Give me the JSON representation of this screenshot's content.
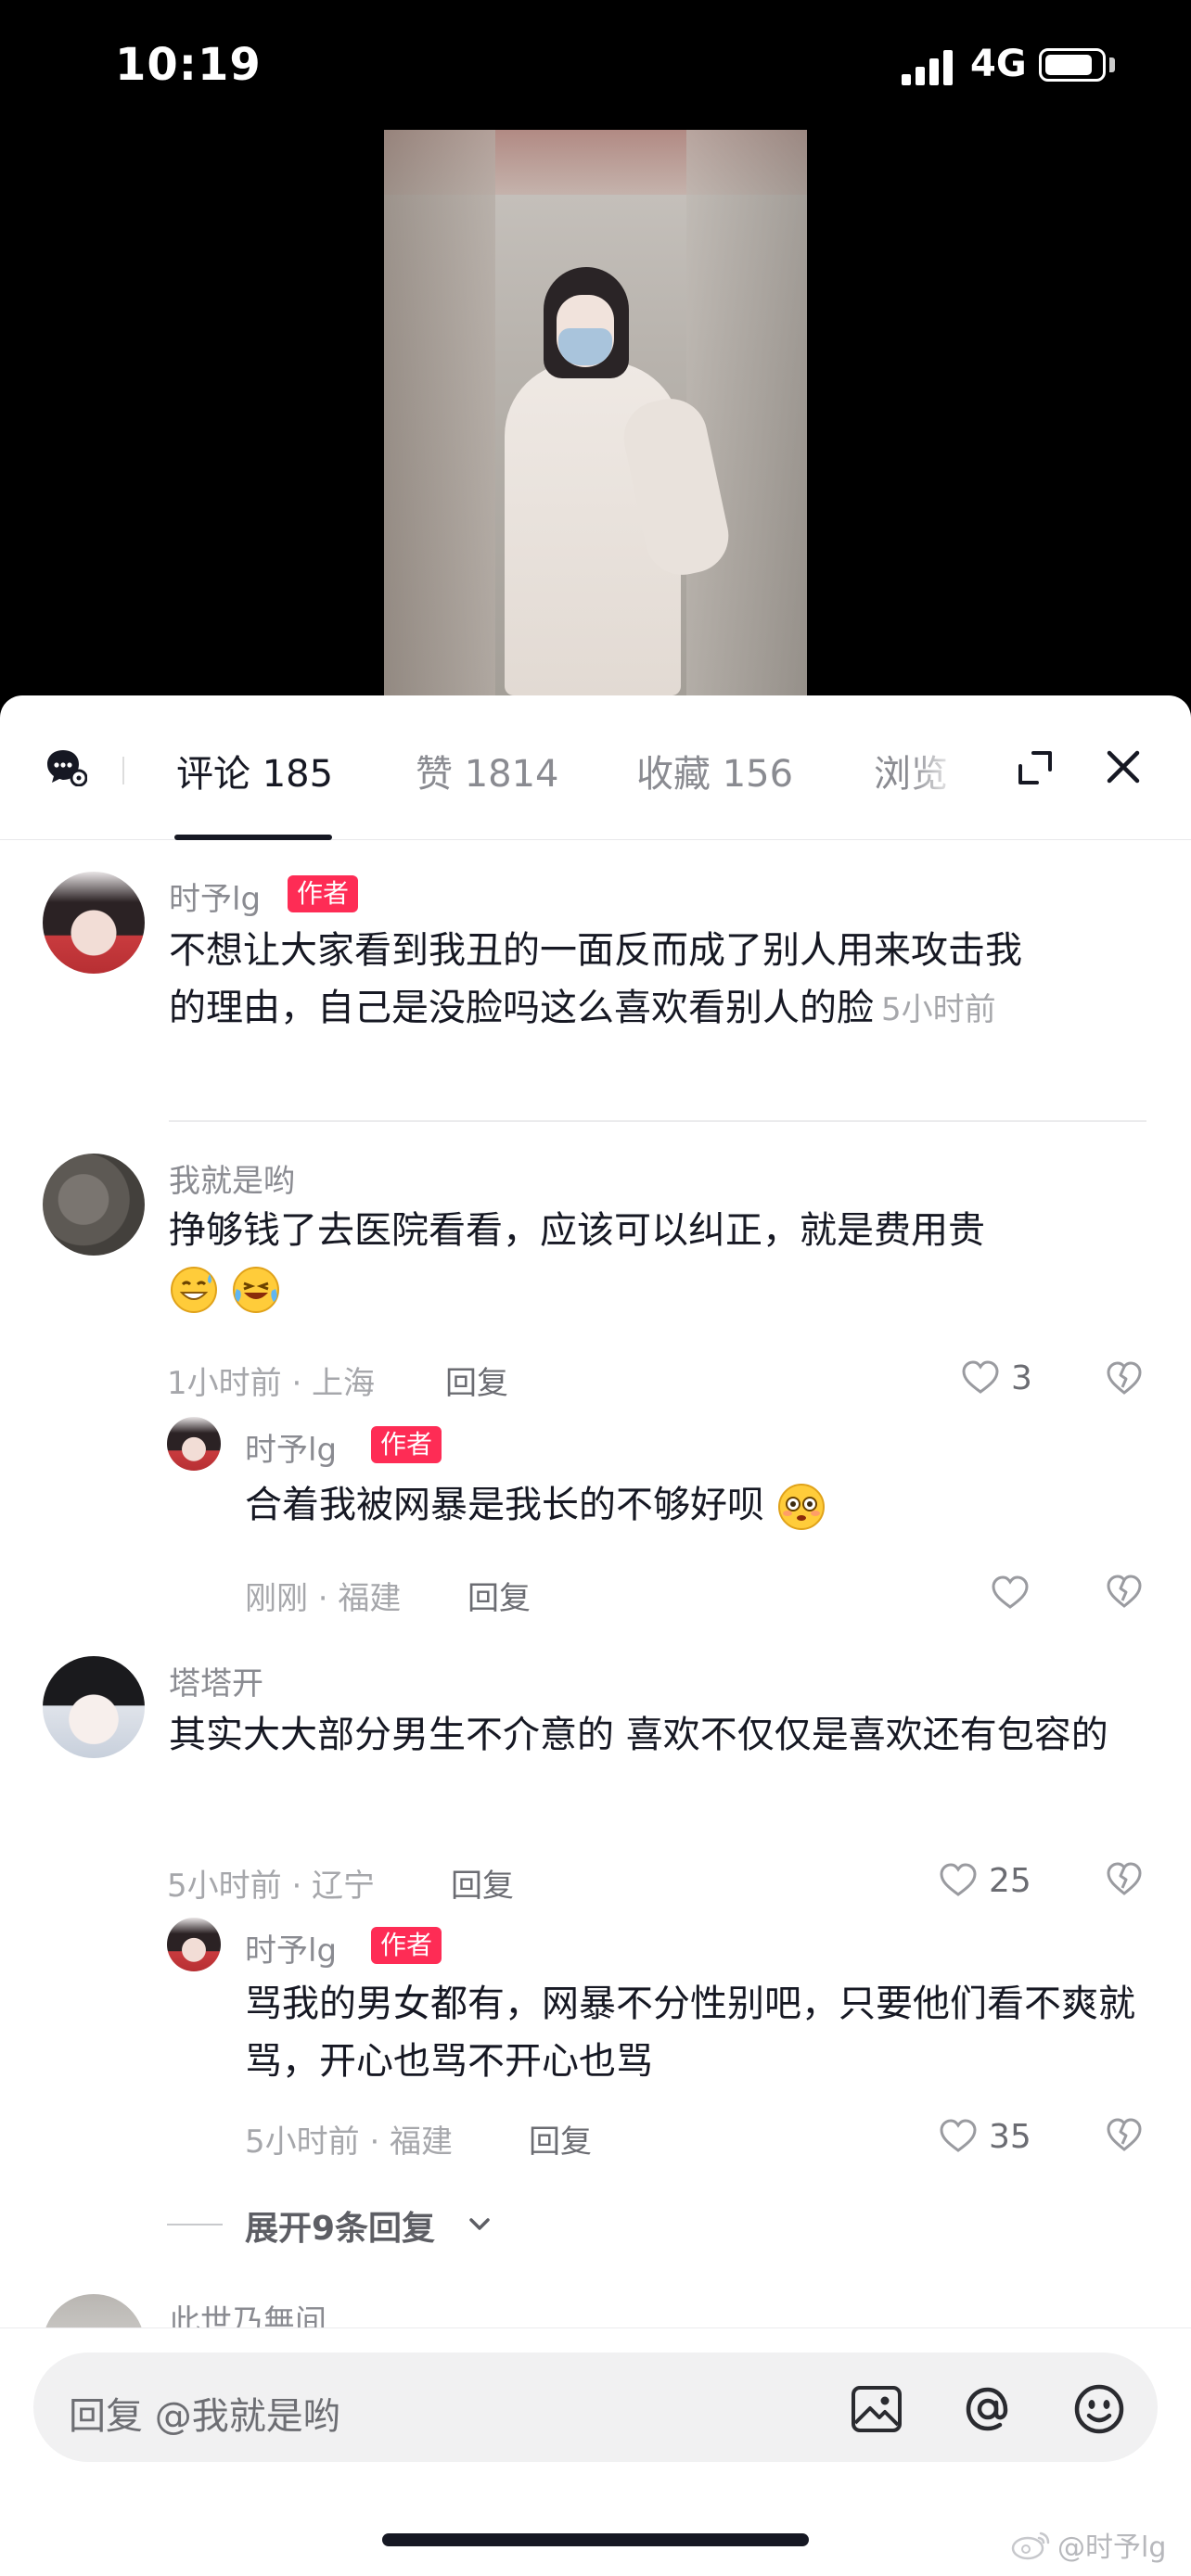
{
  "status": {
    "time": "10:19",
    "network": "4G"
  },
  "tabs": [
    {
      "label": "评论 185",
      "active": true
    },
    {
      "label": "赞 1814",
      "active": false
    },
    {
      "label": "收藏 156",
      "active": false
    },
    {
      "label": "浏览",
      "active": false
    }
  ],
  "comments": [
    {
      "user": "时予lg",
      "badge": "作者",
      "text": "不想让大家看到我丑的一面反而成了别人用来攻击我的理由，自己是没脸吗这么喜欢看别人的脸",
      "time": "5小时前"
    },
    {
      "user": "我就是哟",
      "text": "挣够钱了去医院看看，应该可以纠正，就是费用贵",
      "emojis": [
        "grin-sweat-emoji",
        "cry-laugh-emoji"
      ],
      "meta": "1小时前 · 上海",
      "reply_label": "回复",
      "likes": "3",
      "replies": [
        {
          "user": "时予lg",
          "badge": "作者",
          "text": "合着我被网暴是我长的不够好呗",
          "emojis": [
            "flushed-emoji"
          ],
          "meta": "刚刚 · 福建",
          "reply_label": "回复"
        }
      ]
    },
    {
      "user": "塔塔开",
      "text": "其实大大部分男生不介意的 喜欢不仅仅是喜欢还有包容的",
      "meta": "5小时前 · 辽宁",
      "reply_label": "回复",
      "likes": "25",
      "replies": [
        {
          "user": "时予lg",
          "badge": "作者",
          "text": "骂我的男女都有，网暴不分性别吧，只要他们看不爽就骂，开心也骂不开心也骂",
          "meta": "5小时前 · 福建",
          "reply_label": "回复",
          "likes": "35"
        }
      ],
      "expand_label": "展开9条回复"
    },
    {
      "user": "此世乃無间"
    }
  ],
  "input": {
    "placeholder": "回复 @我就是哟"
  },
  "watermark": "@时予lg",
  "colors": {
    "accent": "#fe2c55",
    "text": "#161823",
    "muted": "#8a8b91"
  }
}
